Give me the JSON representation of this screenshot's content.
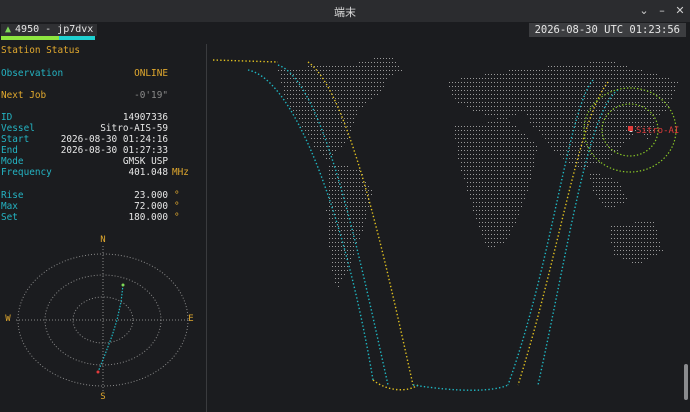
{
  "window": {
    "title": "端末"
  },
  "header": {
    "station_label": "4950 - jp7dvx",
    "station_progress": 0.62,
    "clock": "2026-08-30 UTC 01:23:56"
  },
  "station_status": {
    "heading": "Station Status",
    "observation_label": "Observation",
    "observation_value": "ONLINE",
    "next_job_label": "Next Job",
    "next_job_value": "-0'19\"",
    "fields": [
      {
        "label": "ID",
        "value": "14907336",
        "unit": ""
      },
      {
        "label": "Vessel",
        "value": "Sitro-AIS-59",
        "unit": ""
      },
      {
        "label": "Start",
        "value": "2026-08-30 01:24:16",
        "unit": ""
      },
      {
        "label": "End",
        "value": "2026-08-30 01:27:33",
        "unit": ""
      },
      {
        "label": "Mode",
        "value": "GMSK USP",
        "unit": ""
      },
      {
        "label": "Frequency",
        "value": "401.048",
        "unit": "MHz"
      }
    ],
    "pass": [
      {
        "label": "Rise",
        "value": "23.000",
        "unit": "°"
      },
      {
        "label": "Max",
        "value": "72.000",
        "unit": "°"
      },
      {
        "label": "Set",
        "value": "180.000",
        "unit": "°"
      }
    ]
  },
  "polar_plot": {
    "north": "N",
    "east": "E",
    "south": "S",
    "west": "W"
  },
  "map": {
    "satellite_label": "Sitro-AI",
    "colors": {
      "track_yellow": "#e0c020",
      "track_cyan": "#1fb8c4",
      "land": "#9a9a9a",
      "footprint": "#8ac926",
      "satellite": "#e23b3b"
    }
  }
}
